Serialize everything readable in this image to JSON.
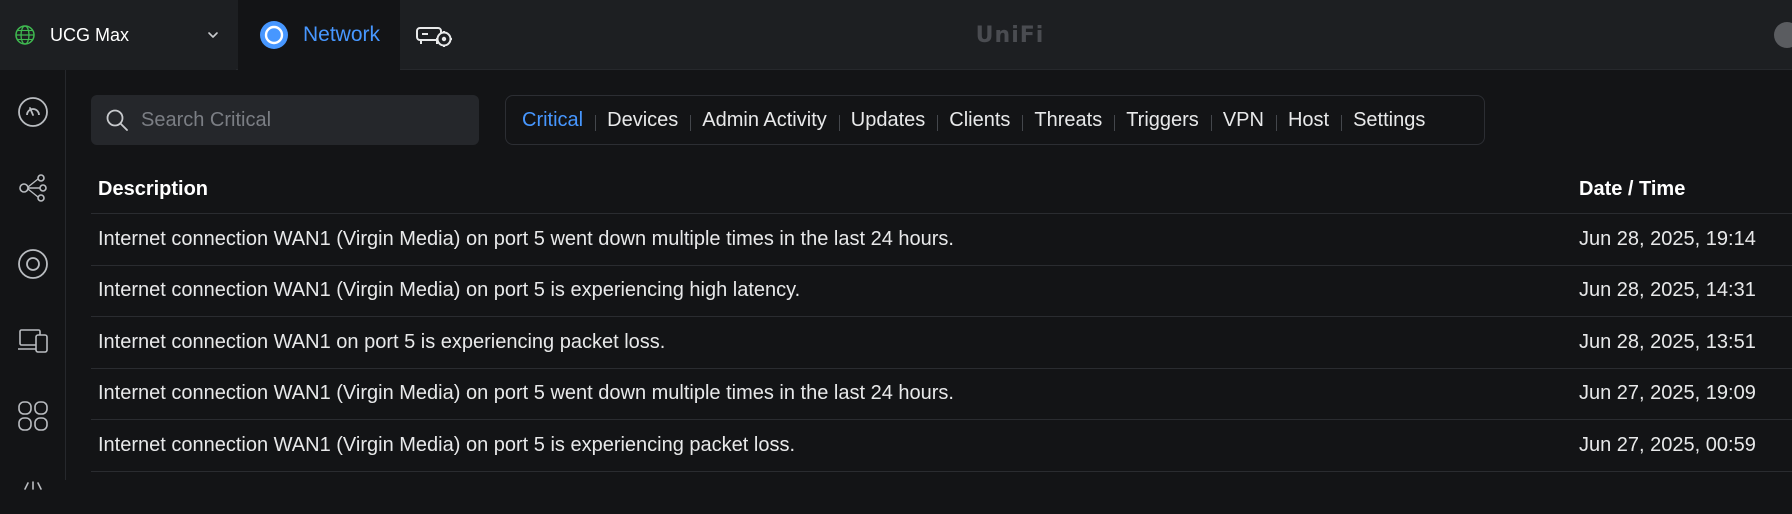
{
  "topbar": {
    "console_name": "UCG Max",
    "app_label": "Network",
    "brand": "UniFi"
  },
  "colors": {
    "accent": "#4797ff",
    "globe": "#3fb950",
    "background": "#131416",
    "topbar": "#1d1f22"
  },
  "sidebar": {
    "items": [
      {
        "icon": "dashboard-icon"
      },
      {
        "icon": "topology-icon"
      },
      {
        "icon": "unifi-devices-icon"
      },
      {
        "icon": "client-devices-icon"
      },
      {
        "icon": "apps-icon"
      },
      {
        "icon": "more-icon"
      }
    ]
  },
  "search": {
    "placeholder": "Search Critical",
    "value": ""
  },
  "tabs": [
    {
      "label": "Critical",
      "active": true
    },
    {
      "label": "Devices"
    },
    {
      "label": "Admin Activity"
    },
    {
      "label": "Updates"
    },
    {
      "label": "Clients"
    },
    {
      "label": "Threats"
    },
    {
      "label": "Triggers"
    },
    {
      "label": "VPN"
    },
    {
      "label": "Host"
    },
    {
      "label": "Settings"
    }
  ],
  "table": {
    "headers": {
      "description": "Description",
      "datetime": "Date / Time"
    },
    "rows": [
      {
        "description": "Internet connection WAN1 (Virgin Media) on port 5 went down multiple times in the last 24 hours.",
        "datetime": "Jun 28, 2025, 19:14"
      },
      {
        "description": "Internet connection WAN1 (Virgin Media) on port 5 is experiencing high latency.",
        "datetime": "Jun 28, 2025, 14:31"
      },
      {
        "description": "Internet connection WAN1 on port 5 is experiencing packet loss.",
        "datetime": "Jun 28, 2025, 13:51"
      },
      {
        "description": "Internet connection WAN1 (Virgin Media) on port 5 went down multiple times in the last 24 hours.",
        "datetime": "Jun 27, 2025, 19:09"
      },
      {
        "description": "Internet connection WAN1 (Virgin Media) on port 5 is experiencing packet loss.",
        "datetime": "Jun 27, 2025, 00:59"
      }
    ]
  }
}
